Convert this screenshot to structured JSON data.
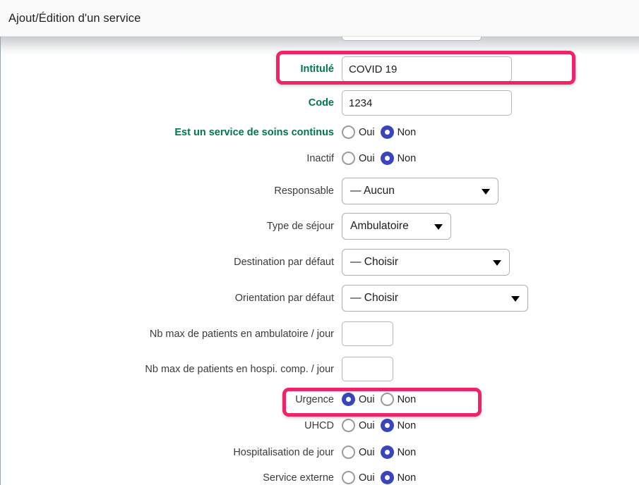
{
  "window": {
    "title": "Ajout/Édition d'un service"
  },
  "form": {
    "fields": [
      {
        "label": "Intitulé",
        "value": "COVID 19",
        "type": "text",
        "emphasis": "green"
      },
      {
        "label": "Code",
        "value": "1234",
        "type": "text",
        "emphasis": "green"
      },
      {
        "label": "Est un service de soins continus",
        "type": "radio",
        "emphasis": "green",
        "selected": "Non"
      },
      {
        "label": "Inactif",
        "type": "radio",
        "emphasis": "normal",
        "selected": "Non"
      },
      {
        "label": "Responsable",
        "value": "— Aucun",
        "type": "select",
        "emphasis": "normal"
      },
      {
        "label": "Type de séjour",
        "value": "Ambulatoire",
        "type": "select",
        "emphasis": "normal"
      },
      {
        "label": "Destination par défaut",
        "value": "— Choisir",
        "type": "select",
        "emphasis": "normal"
      },
      {
        "label": "Orientation par défaut",
        "value": "— Choisir",
        "type": "select",
        "emphasis": "normal"
      },
      {
        "label": "Nb max de patients en ambulatoire / jour",
        "value": "",
        "type": "number",
        "emphasis": "normal"
      },
      {
        "label": "Nb max de patients en hospi. comp. / jour",
        "value": "",
        "type": "number",
        "emphasis": "normal"
      },
      {
        "label": "Urgence",
        "type": "radio",
        "emphasis": "normal",
        "selected": "Oui"
      },
      {
        "label": "UHCD",
        "type": "radio",
        "emphasis": "normal",
        "selected": "Non"
      },
      {
        "label": "Hospitalisation de jour",
        "type": "radio",
        "emphasis": "normal",
        "selected": "Non"
      },
      {
        "label": "Service externe",
        "type": "radio",
        "emphasis": "normal",
        "selected": "Non"
      }
    ],
    "radio_options": {
      "yes": "Oui",
      "no": "Non"
    }
  },
  "highlights": [
    {
      "target": "Intitulé",
      "color": "#ef2365"
    },
    {
      "target": "Urgence",
      "color": "#ef2365"
    }
  ]
}
